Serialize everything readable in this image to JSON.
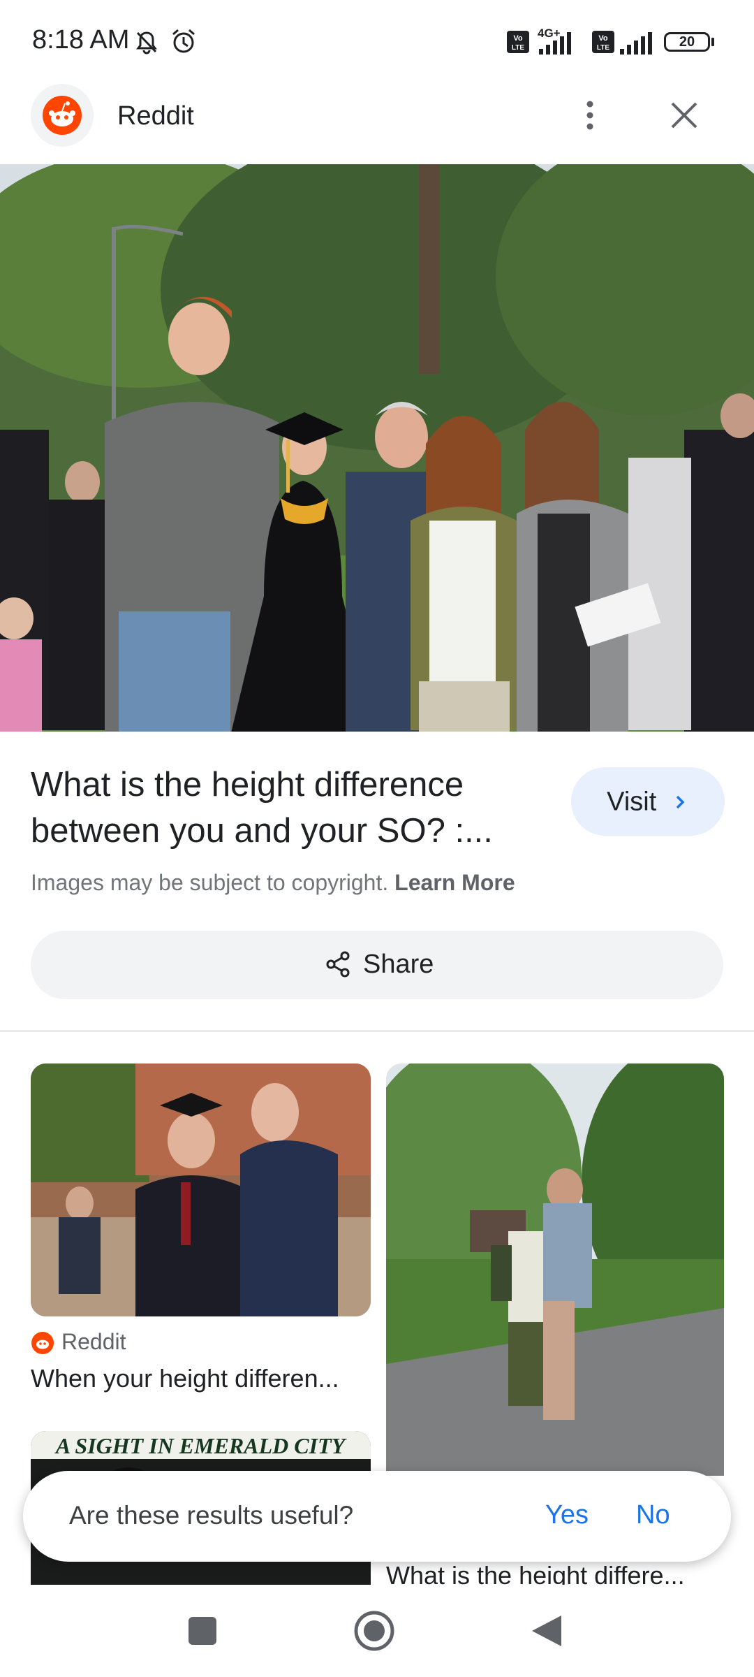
{
  "status_bar": {
    "time": "8:18 AM",
    "network_label": "4G+",
    "volte_label": "Vo LTE",
    "battery": "20"
  },
  "header": {
    "source": "Reddit",
    "icons": [
      "reddit-icon",
      "more-vert-icon",
      "close-icon"
    ]
  },
  "result": {
    "title": "What is the height difference between you and your SO? :...",
    "visit_label": "Visit",
    "copyright_text": "Images may be subject to copyright.",
    "learn_more": "Learn More",
    "share_label": "Share"
  },
  "related": [
    {
      "source": "Reddit",
      "caption": "When your height differen..."
    },
    {
      "caption": "What is the height differe..."
    },
    {
      "sign_text": "A SIGHT IN EMERALD CITY"
    }
  ],
  "feedback": {
    "question": "Are these results useful?",
    "yes": "Yes",
    "no": "No"
  },
  "colors": {
    "accent": "#1a73e8",
    "reddit": "#ff4500",
    "visit_bg": "#e8f0fe"
  },
  "nav": {
    "icons": [
      "recents-square-icon",
      "home-circle-icon",
      "back-triangle-icon"
    ]
  }
}
